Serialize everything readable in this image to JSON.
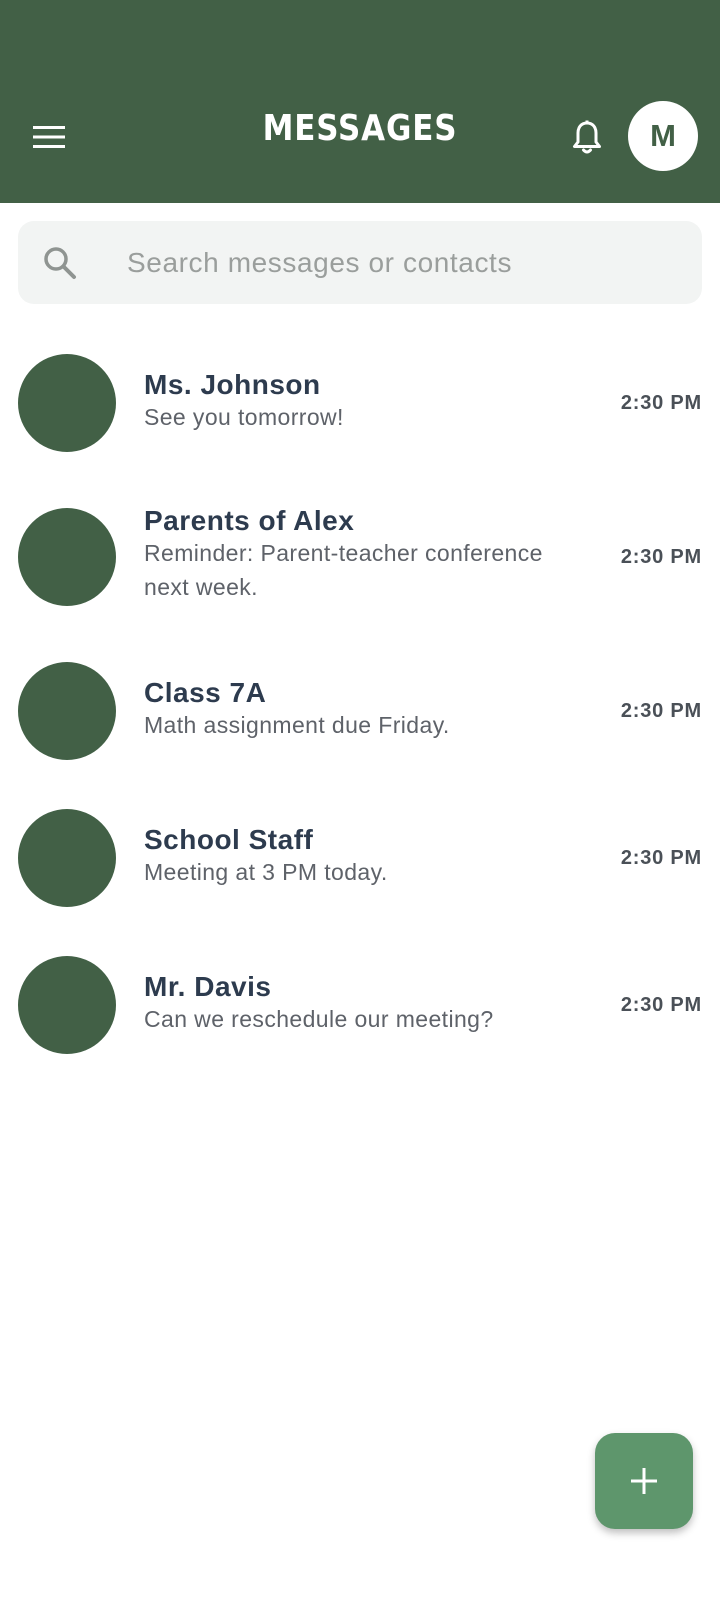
{
  "header": {
    "title": "MESSAGES",
    "avatar_initial": "M",
    "menu_icon": "menu-icon",
    "bell_icon": "bell-icon"
  },
  "search": {
    "placeholder": "Search messages or contacts",
    "value": ""
  },
  "conversations": [
    {
      "name": "Ms. Johnson",
      "preview": "See you tomorrow!",
      "time": "2:30 PM"
    },
    {
      "name": "Parents of Alex",
      "preview": "Reminder: Parent-teacher conference next week.",
      "time": "2:30 PM"
    },
    {
      "name": "Class 7A",
      "preview": "Math assignment due Friday.",
      "time": "2:30 PM"
    },
    {
      "name": "School Staff",
      "preview": "Meeting at 3 PM today.",
      "time": "2:30 PM"
    },
    {
      "name": "Mr. Davis",
      "preview": "Can we reschedule our meeting?",
      "time": "2:30 PM"
    }
  ],
  "fab": {
    "icon": "plus-icon"
  },
  "colors": {
    "primary": "#426046",
    "fab": "#5e966c",
    "search_bg": "#f2f4f3",
    "name_text": "#2d3b4e",
    "preview_text": "#5e6269"
  }
}
